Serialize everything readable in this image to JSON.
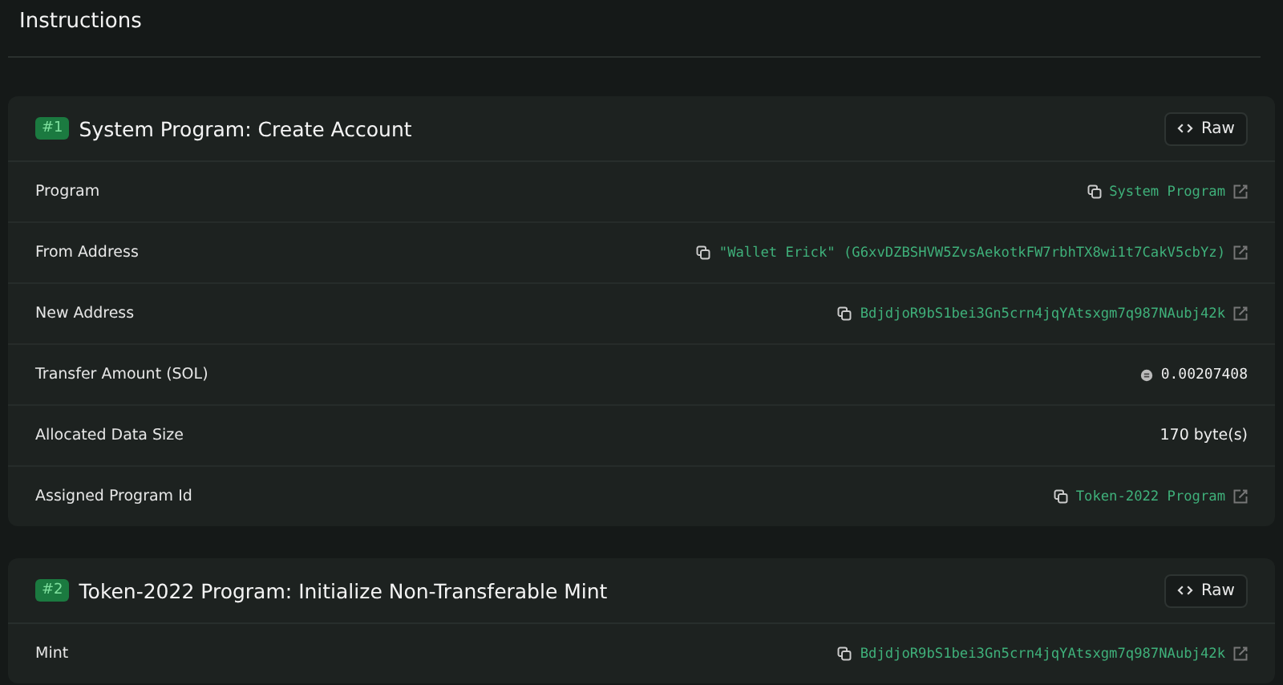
{
  "title": "Instructions",
  "instructions": [
    {
      "number": "#1",
      "name": "System Program: Create Account",
      "raw_button": "Raw",
      "rows": [
        {
          "label": "Program",
          "kind": "address",
          "value": "System Program"
        },
        {
          "label": "From Address",
          "kind": "address",
          "value": "\"Wallet Erick\" (G6xvDZBSHVW5ZvsAekotkFW7rbhTX8wi1t7CakV5cbYz)"
        },
        {
          "label": "New Address",
          "kind": "address",
          "value": "BdjdjoR9bS1bei3Gn5crn4jqYAtsxgm7q987NAubj42k"
        },
        {
          "label": "Transfer Amount (SOL)",
          "kind": "sol",
          "value": "0.00207408"
        },
        {
          "label": "Allocated Data Size",
          "kind": "text",
          "value": "170 byte(s)"
        },
        {
          "label": "Assigned Program Id",
          "kind": "address",
          "value": "Token-2022 Program"
        }
      ]
    },
    {
      "number": "#2",
      "name": "Token-2022 Program: Initialize Non-Transferable Mint",
      "raw_button": "Raw",
      "rows": [
        {
          "label": "Mint",
          "kind": "address",
          "value": "BdjdjoR9bS1bei3Gn5crn4jqYAtsxgm7q987NAubj42k"
        }
      ]
    }
  ]
}
